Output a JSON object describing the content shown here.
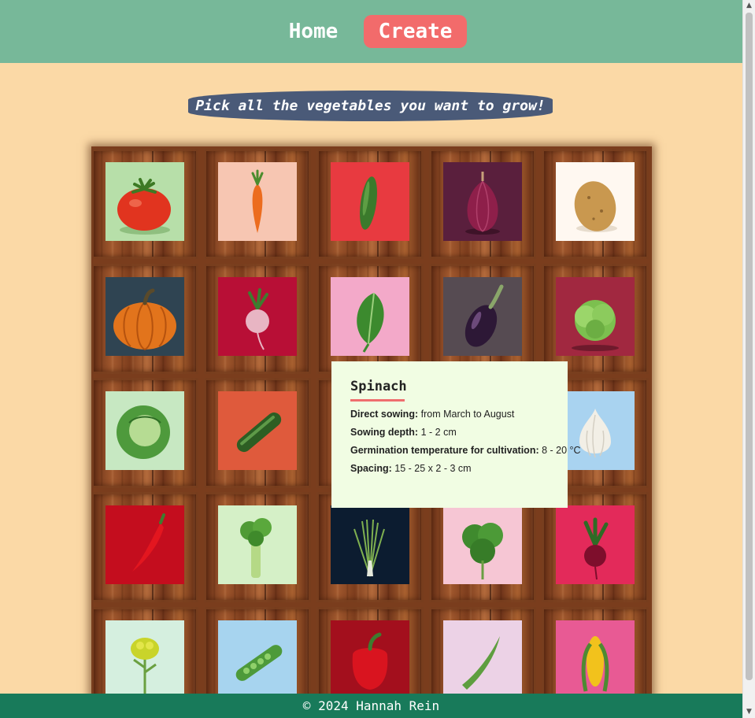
{
  "nav": {
    "home_label": "Home",
    "create_label": "Create"
  },
  "banner": {
    "text": "Pick all the vegetables you want to grow!"
  },
  "vegetables": [
    [
      "tomato",
      "carrot",
      "cucumber",
      "red onion",
      "potato"
    ],
    [
      "pumpkin",
      "radish",
      "spinach",
      "eggplant",
      "lettuce"
    ],
    [
      "cabbage",
      "zucchini",
      "",
      "",
      "garlic"
    ],
    [
      "chili pepper",
      "celery",
      "chives",
      "chard",
      "beetroot"
    ],
    [
      "broccoli",
      "pea pod",
      "bell pepper",
      "snow pea",
      "corn"
    ]
  ],
  "tooltip": {
    "title": "Spinach",
    "rows": [
      {
        "label": "Direct sowing:",
        "value": "from March to August"
      },
      {
        "label": "Sowing depth:",
        "value": "1 - 2 cm"
      },
      {
        "label": "Germination temperature for cultivation:",
        "value": "8 - 20 °C"
      },
      {
        "label": "Spacing:",
        "value": "15 - 25 x 2 - 3 cm"
      }
    ]
  },
  "footer": {
    "text": "© 2024 Hannah Rein"
  },
  "icons": {
    "scroll_up": "triangle-up-icon",
    "scroll_down": "triangle-down-icon"
  },
  "colors": {
    "header": "#77b899",
    "accent": "#f26b6b",
    "banner": "#4a5a78",
    "footer": "#187a5a",
    "page": "#fbd9a6"
  }
}
